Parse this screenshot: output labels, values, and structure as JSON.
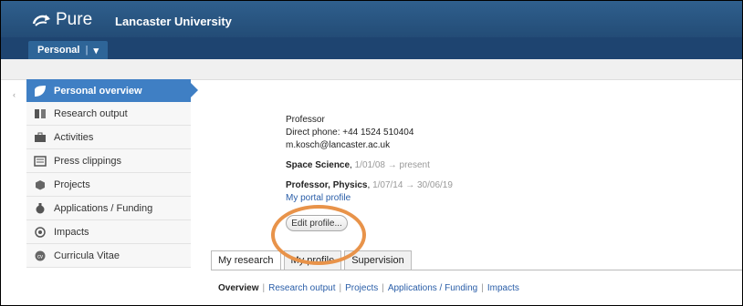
{
  "header": {
    "logo_text": "Pure",
    "university": "Lancaster University",
    "tab_label": "Personal",
    "tab_dropdown": "▾"
  },
  "sidebar": {
    "items": [
      {
        "label": "Personal overview",
        "icon": "leaf-icon",
        "active": true
      },
      {
        "label": "Research output",
        "icon": "book-icon"
      },
      {
        "label": "Activities",
        "icon": "briefcase-icon"
      },
      {
        "label": "Press clippings",
        "icon": "newspaper-icon"
      },
      {
        "label": "Projects",
        "icon": "cube-icon"
      },
      {
        "label": "Applications / Funding",
        "icon": "money-bag-icon"
      },
      {
        "label": "Impacts",
        "icon": "target-icon"
      },
      {
        "label": "Curricula Vitae",
        "icon": "cv-icon"
      }
    ]
  },
  "profile": {
    "title": "Professor",
    "phone": "Direct phone: +44 1524 510404",
    "email": "m.kosch@lancaster.ac.uk",
    "affiliations": [
      {
        "name": "Space Science",
        "dates": "1/01/08 → present"
      },
      {
        "name": "Professor, Physics",
        "dates": "1/07/14 → 30/06/19"
      }
    ],
    "portal_link": "My portal profile",
    "edit_button": "Edit profile..."
  },
  "tabs": [
    "My research",
    "My profile",
    "Supervision"
  ],
  "subnav": [
    "Overview",
    "Research output",
    "Projects",
    "Applications / Funding",
    "Impacts"
  ],
  "colors": {
    "header": "#2f5f8d",
    "active": "#3f7fc4",
    "highlight": "#e8934a"
  }
}
